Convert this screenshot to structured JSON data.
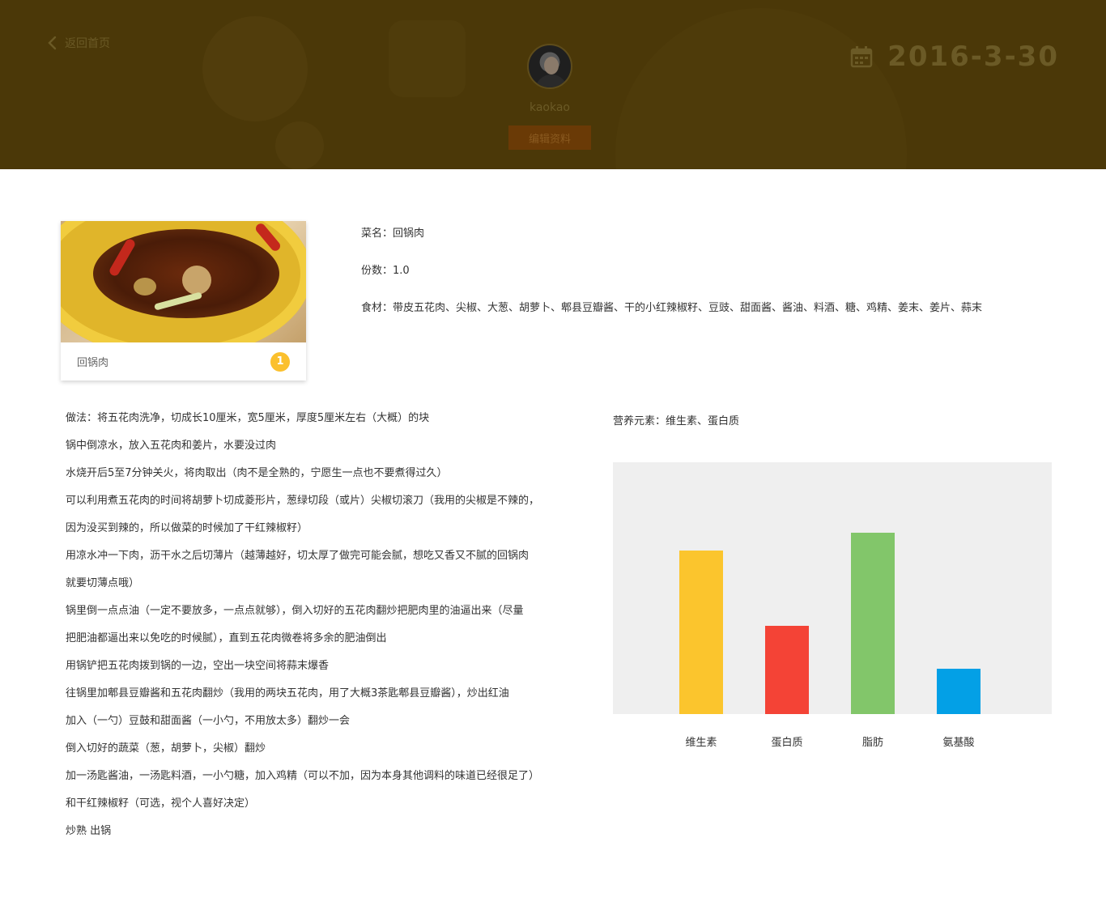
{
  "header": {
    "back_label": "返回首页",
    "back_icon": "chevron-left-icon",
    "username": "kaokao",
    "edit_label": "编辑资料",
    "calendar_icon": "calendar-icon",
    "date": "2016-3-30",
    "banner_color": "#4b3808"
  },
  "dish": {
    "name": "回锅肉",
    "count": "1",
    "badge_color": "#fbc02d",
    "info_name": "菜名：回锅肉",
    "info_portion": "份数：1.0",
    "info_ingredients": "食材：带皮五花肉、尖椒、大葱、胡萝卜、郫县豆瓣酱、干的小红辣椒籽、豆豉、甜面酱、酱油、料酒、糖、鸡精、姜末、姜片、蒜末"
  },
  "method": [
    "做法：将五花肉洗净，切成长10厘米，宽5厘米，厚度5厘米左右（大概）的块",
    "锅中倒凉水，放入五花肉和姜片，水要没过肉",
    "水烧开后5至7分钟关火，将肉取出（肉不是全熟的，宁愿生一点也不要煮得过久）",
    "可以利用煮五花肉的时间将胡萝卜切成菱形片，葱绿切段（或片）尖椒切滚刀（我用的尖椒是不辣的，",
    "因为没买到辣的，所以做菜的时候加了干红辣椒籽）",
    "用凉水冲一下肉，沥干水之后切薄片（越薄越好，切太厚了做完可能会腻，想吃又香又不腻的回锅肉",
    "就要切薄点哦）",
    "锅里倒一点点油（一定不要放多，一点点就够），倒入切好的五花肉翻炒把肥肉里的油逼出来（尽量",
    "把肥油都逼出来以免吃的时候腻），直到五花肉微卷将多余的肥油倒出",
    "用锅铲把五花肉拨到锅的一边，空出一块空间将蒜末爆香",
    "往锅里加郫县豆瓣酱和五花肉翻炒（我用的两块五花肉，用了大概3茶匙郫县豆瓣酱），炒出红油",
    "加入（一勺）豆鼓和甜面酱（一小勺，不用放太多）翻炒一会",
    "倒入切好的蔬菜（葱，胡萝卜，尖椒）翻炒",
    "加一汤匙酱油，一汤匙料酒，一小勺糖，加入鸡精（可以不加，因为本身其他调料的味道已经很足了）",
    "和干红辣椒籽（可选，视个人喜好决定）",
    "炒熟 出锅"
  ],
  "nutrition": {
    "label": "营养元素：维生素、蛋白质"
  },
  "chart_data": {
    "type": "bar",
    "categories": [
      "维生素",
      "蛋白质",
      "脂肪",
      "氨基酸"
    ],
    "values": [
      65,
      35,
      72,
      18
    ],
    "colors": [
      "#fbc52d",
      "#f44336",
      "#82c66a",
      "#03a0e6"
    ],
    "ylim": [
      0,
      100
    ],
    "grid": false,
    "title": "",
    "xlabel": "",
    "ylabel": ""
  }
}
